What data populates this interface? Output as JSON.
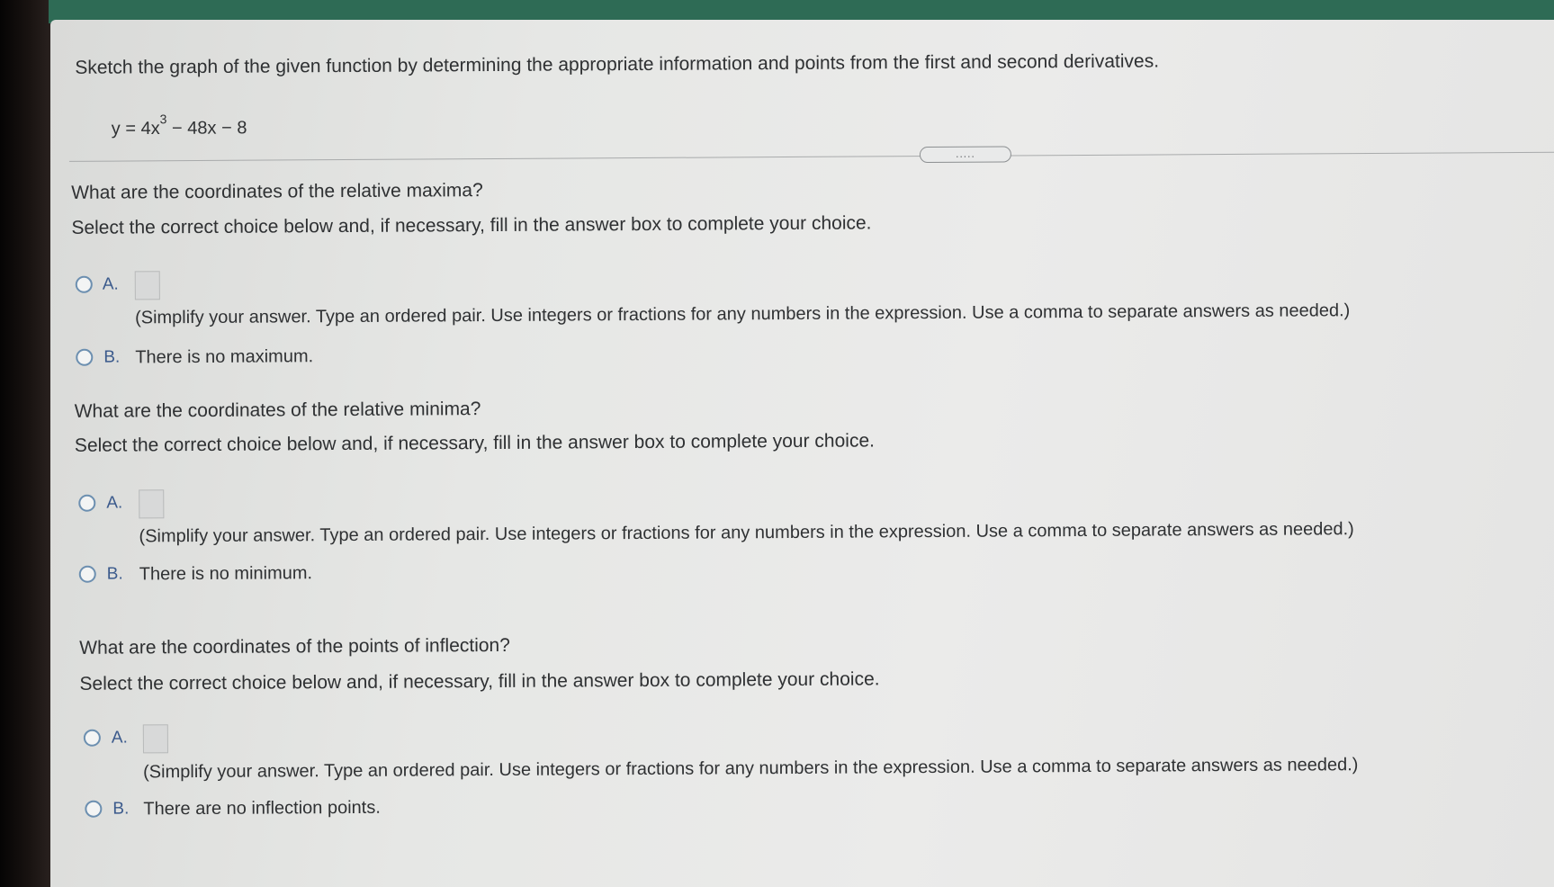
{
  "header": {
    "prompt": "Sketch the graph of the given function by determining the appropriate information and points from the first and second derivatives.",
    "equation": {
      "prefix": "y = 4x",
      "exponent": "3",
      "suffix": " − 48x − 8"
    },
    "expand_label": "....."
  },
  "sections": [
    {
      "question": "What are the coordinates of the relative maxima?",
      "instruction": "Select the correct choice below and, if necessary, fill in the answer box to complete your choice.",
      "choice_a_letter": "A.",
      "choice_a_hint": "(Simplify your answer. Type an ordered pair. Use integers or fractions for any numbers in the expression. Use a comma to separate answers as needed.)",
      "choice_b_letter": "B.",
      "choice_b_text": "There is no maximum."
    },
    {
      "question": "What are the coordinates of the relative minima?",
      "instruction": "Select the correct choice below and, if necessary, fill in the answer box to complete your choice.",
      "choice_a_letter": "A.",
      "choice_a_hint": "(Simplify your answer. Type an ordered pair. Use integers or fractions for any numbers in the expression. Use a comma to separate answers as needed.)",
      "choice_b_letter": "B.",
      "choice_b_text": "There is no minimum."
    },
    {
      "question": "What are the coordinates of the points of inflection?",
      "instruction": "Select the correct choice below and, if necessary, fill in the answer box to complete your choice.",
      "choice_a_letter": "A.",
      "choice_a_hint": "(Simplify your answer. Type an ordered pair. Use integers or fractions for any numbers in the expression. Use a comma to separate answers as needed.)",
      "choice_b_letter": "B.",
      "choice_b_text": "There are no inflection points."
    }
  ]
}
